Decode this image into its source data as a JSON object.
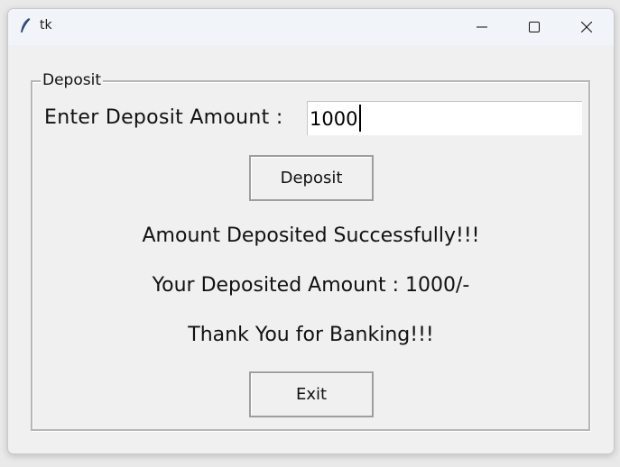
{
  "window": {
    "title": "tk"
  },
  "titlebar": {
    "icons": [
      "feather-icon",
      "minimize-icon",
      "maximize-icon",
      "close-icon"
    ]
  },
  "deposit_frame": {
    "label": "Deposit",
    "prompt_label": "Enter Deposit Amount :",
    "amount_value": "1000",
    "deposit_button_label": "Deposit",
    "messages": {
      "success": "Amount Deposited Successfully!!!",
      "amount_line": "Your Deposited Amount : 1000/-",
      "thanks": "Thank You for Banking!!!"
    },
    "exit_button_label": "Exit"
  },
  "colors": {
    "window_bg": "#f0f0f0",
    "titlebar_bg": "#f1f4f9",
    "input_bg": "#ffffff"
  }
}
